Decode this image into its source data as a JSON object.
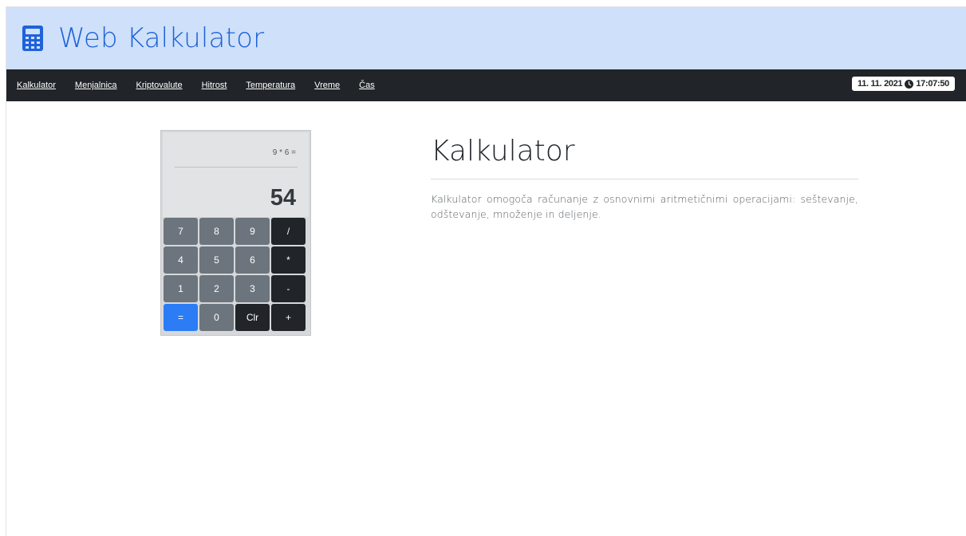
{
  "header": {
    "title": "Web Kalkulator",
    "logo_icon": "calculator-icon",
    "accent": "#1e63d9",
    "background": "#cfe0fa"
  },
  "nav": {
    "items": [
      {
        "label": "Kalkulator"
      },
      {
        "label": "Menjalnica"
      },
      {
        "label": "Kriptovalute"
      },
      {
        "label": "Hitrost"
      },
      {
        "label": "Temperatura"
      },
      {
        "label": "Vreme"
      },
      {
        "label": "Čas"
      }
    ],
    "clock": {
      "date": "11. 11. 2021",
      "time": "17:07:50",
      "icon": "clock-icon"
    }
  },
  "calculator": {
    "expression": "9 * 6 =",
    "result": "54",
    "keys": [
      {
        "label": "7",
        "kind": "num"
      },
      {
        "label": "8",
        "kind": "num"
      },
      {
        "label": "9",
        "kind": "num"
      },
      {
        "label": "/",
        "kind": "op"
      },
      {
        "label": "4",
        "kind": "num"
      },
      {
        "label": "5",
        "kind": "num"
      },
      {
        "label": "6",
        "kind": "num"
      },
      {
        "label": "*",
        "kind": "op"
      },
      {
        "label": "1",
        "kind": "num"
      },
      {
        "label": "2",
        "kind": "num"
      },
      {
        "label": "3",
        "kind": "num"
      },
      {
        "label": "-",
        "kind": "op"
      },
      {
        "label": "=",
        "kind": "eq"
      },
      {
        "label": "0",
        "kind": "num"
      },
      {
        "label": "Clr",
        "kind": "op"
      },
      {
        "label": "+",
        "kind": "op"
      }
    ]
  },
  "main": {
    "heading": "Kalkulator",
    "description": "Kalkulator omogoča računanje z osnovnimi aritmetičnimi operacijami: seštevanje, odštevanje, množenje in deljenje."
  }
}
